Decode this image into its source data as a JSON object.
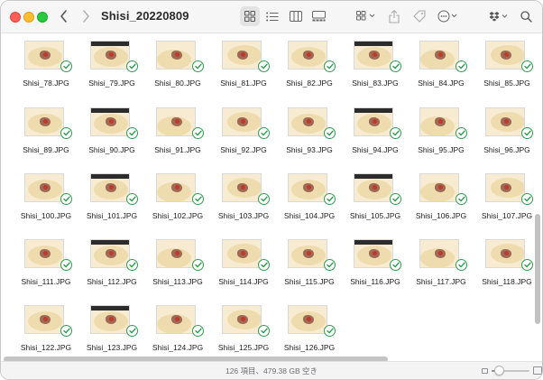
{
  "window": {
    "title": "Shisi_20220809"
  },
  "toolbar": {
    "back_icon": "chevron-left-icon",
    "forward_icon": "chevron-right-icon",
    "view_modes": [
      "icon-view",
      "list-view",
      "column-view",
      "gallery-view"
    ],
    "active_view": "icon-view",
    "right_icons": [
      "group-icon",
      "share-icon",
      "tag-icon",
      "more-icon",
      "dropbox-icon",
      "search-icon"
    ]
  },
  "files": {
    "rows": [
      [
        "Shisi_78.JPG",
        "Shisi_79.JPG",
        "Shisi_80.JPG",
        "Shisi_81.JPG",
        "Shisi_82.JPG",
        "Shisi_83.JPG",
        "Shisi_84.JPG",
        "Shisi_85.JPG"
      ],
      [
        "Shisi_89.JPG",
        "Shisi_90.JPG",
        "Shisi_91.JPG",
        "Shisi_92.JPG",
        "Shisi_93.JPG",
        "Shisi_94.JPG",
        "Shisi_95.JPG",
        "Shisi_96.JPG"
      ],
      [
        "Shisi_100.JPG",
        "Shisi_101.JPG",
        "Shisi_102.JPG",
        "Shisi_103.JPG",
        "Shisi_104.JPG",
        "Shisi_105.JPG",
        "Shisi_106.JPG",
        "Shisi_107.JPG"
      ],
      [
        "Shisi_111.JPG",
        "Shisi_112.JPG",
        "Shisi_113.JPG",
        "Shisi_114.JPG",
        "Shisi_115.JPG",
        "Shisi_116.JPG",
        "Shisi_117.JPG",
        "Shisi_118.JPG"
      ],
      [
        "Shisi_122.JPG",
        "Shisi_123.JPG",
        "Shisi_124.JPG",
        "Shisi_125.JPG",
        "Shisi_126.JPG"
      ]
    ],
    "sync_status_icon": "synced-checkmark-icon",
    "status_color": "#2e9e4f"
  },
  "statusbar": {
    "text": "126 項目、479.38 GB 空き"
  },
  "zoom": {
    "level": 0.2
  }
}
